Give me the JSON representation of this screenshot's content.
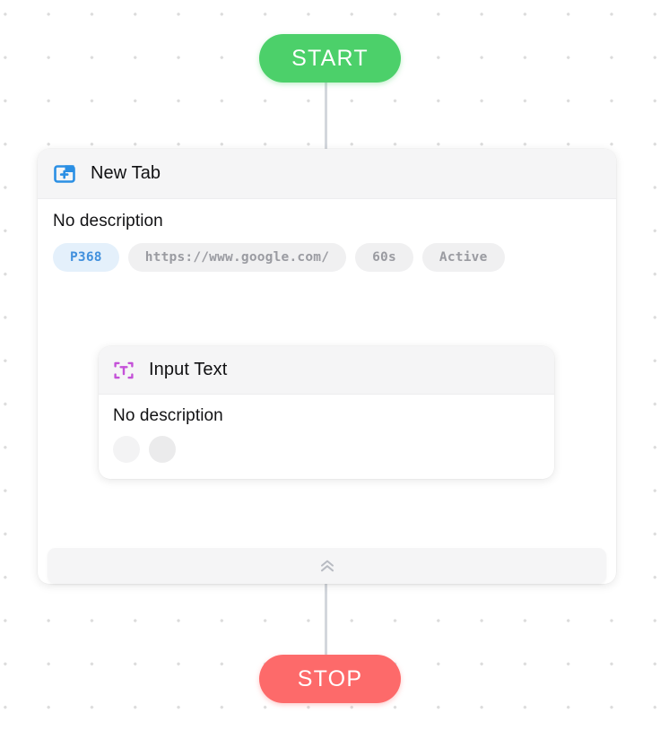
{
  "canvas": {
    "background_color": "#ffffff",
    "dot_color": "#dcdcdc"
  },
  "flow": {
    "start_label": "START",
    "stop_label": "STOP",
    "start_color": "#4cd06a",
    "stop_color": "#fd6a6a",
    "connector_color": "#d3d7dc"
  },
  "nodes": [
    {
      "icon": "new-tab-icon",
      "icon_color": "#2b8fe4",
      "title": "New Tab",
      "description": "No description",
      "badges": [
        {
          "label": "P368",
          "style": "id",
          "color": "#4190dd",
          "background": "#e4f0fb"
        },
        {
          "label": "https://www.google.com/",
          "style": "gray",
          "color": "#9a9ba1",
          "background": "#f0f0f1"
        },
        {
          "label": "60s",
          "style": "gray",
          "color": "#9a9ba1",
          "background": "#f0f0f1"
        },
        {
          "label": "Active",
          "style": "gray",
          "color": "#9a9ba1",
          "background": "#f0f0f1"
        }
      ]
    },
    {
      "icon": "input-text-icon",
      "icon_color": "#c451d8",
      "title": "Input Text",
      "description": "No description",
      "badges": [
        {
          "label": "",
          "style": "dot",
          "background": "#f3f3f4"
        },
        {
          "label": "",
          "style": "dot",
          "background": "#ebebec"
        }
      ]
    }
  ],
  "collapse": {
    "icon": "double-chevron-up-icon",
    "color": "#b8bbc2"
  }
}
